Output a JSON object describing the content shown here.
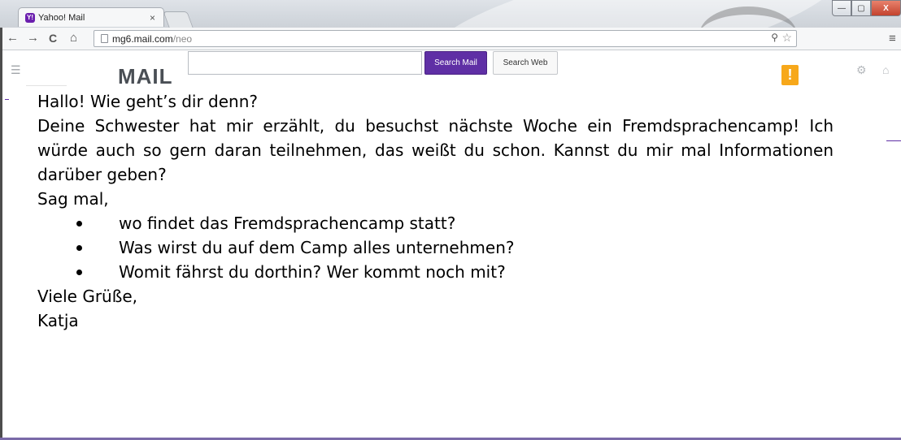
{
  "browser": {
    "tab_title": "Yahoo! Mail",
    "tab_close": "×",
    "favicon_text": "Y!",
    "url_host": "mg6.mail.com",
    "url_path": "/neo",
    "window_controls": {
      "minimize": "—",
      "maximize": "▢",
      "close": "X"
    },
    "nav": {
      "back": "←",
      "forward": "→",
      "reload": "C",
      "home": "⌂"
    },
    "menu": "≡"
  },
  "mail_header": {
    "logo": "MAIL",
    "search_placeholder": "",
    "search_mail_label": "Search Mail",
    "search_web_label": "Search Web",
    "alert_glyph": "!"
  },
  "letter": {
    "greeting": "Hallo! Wie geht’s dir denn?",
    "paragraph": "Deine Schwester hat mir erzählt, du besuchst nächste Woche ein Fremdsprachencamp! Ich würde auch so gern daran teilnehmen, das weißt du schon. Kannst du mir mal Informationen darüber geben?",
    "intro": "Sag mal,",
    "questions": [
      "wo findet das Fremdsprachencamp statt?",
      "Was wirst du auf dem Camp alles unternehmen?",
      "Womit fährst du dorthin? Wer kommt noch mit?"
    ],
    "closing": "Viele Grüße,",
    "signature": "Katja"
  },
  "colors": {
    "accent": "#5f2fa5",
    "alert": "#f7a81a"
  }
}
